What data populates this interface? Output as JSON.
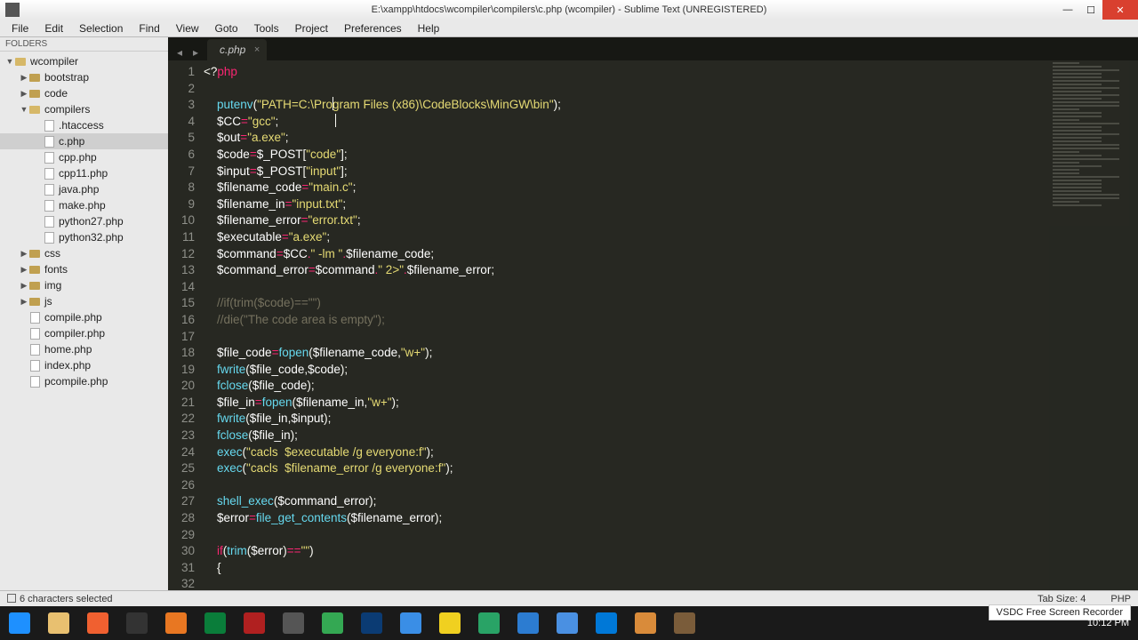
{
  "title": "E:\\xampp\\htdocs\\wcompiler\\compilers\\c.php (wcompiler) - Sublime Text (UNREGISTERED)",
  "menu": [
    "File",
    "Edit",
    "Selection",
    "Find",
    "View",
    "Goto",
    "Tools",
    "Project",
    "Preferences",
    "Help"
  ],
  "sidebar": {
    "header": "FOLDERS",
    "root": "wcompiler",
    "folders_l2": [
      "bootstrap",
      "code"
    ],
    "folder_compilers": "compilers",
    "compilers_files": [
      ".htaccess",
      "c.php",
      "cpp.php",
      "cpp11.php",
      "java.php",
      "make.php",
      "python27.php",
      "python32.php"
    ],
    "folders_l2b": [
      "css",
      "fonts",
      "img",
      "js"
    ],
    "files_root": [
      "compile.php",
      "compiler.php",
      "home.php",
      "index.php",
      "pcompile.php"
    ]
  },
  "tab": {
    "label": "c.php"
  },
  "lines": [
    1,
    2,
    3,
    4,
    5,
    6,
    7,
    8,
    9,
    10,
    11,
    12,
    13,
    14,
    15,
    16,
    17,
    18,
    19,
    20,
    21,
    22,
    23,
    24,
    25,
    26,
    27,
    28,
    29,
    30,
    31,
    32
  ],
  "status": {
    "left": "6 characters selected",
    "tab": "Tab Size: 4",
    "lang": "PHP"
  },
  "taskbar_colors": [
    "#1e90ff",
    "#e8c070",
    "#f06030",
    "#333333",
    "#e87722",
    "#0a7d3a",
    "#b02020",
    "#555555",
    "#34a853",
    "#0b3b73",
    "#3a8ee6",
    "#f0d020",
    "#29a366",
    "#2c7cd1",
    "#4a90e2",
    "#0078d7",
    "#d98b3a",
    "#7a5c3a"
  ],
  "rec": "VSDC Free Screen Recorder",
  "clock": "10:12 PM"
}
